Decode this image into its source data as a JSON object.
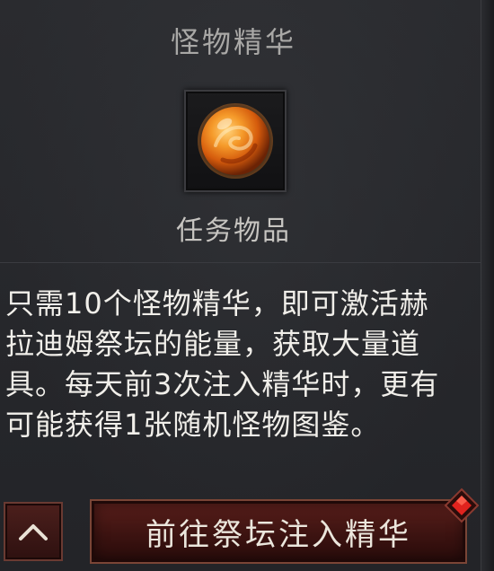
{
  "item": {
    "name": "怪物精华",
    "type": "任务物品",
    "icon": "orange-orb-icon"
  },
  "description": {
    "lines": [
      "只需10个怪物精华，即可激活赫",
      "拉迪姆祭坛的能量，获取大量道",
      "具。每天前3次注入精华时，更有",
      "可能获得1张随机怪物图鉴。"
    ]
  },
  "footer": {
    "back_icon": "chevron-up-icon",
    "action_label": "前往祭坛注入精华",
    "notification_icon": "red-diamond-icon"
  },
  "colors": {
    "background": "#26272b",
    "button": "#4a1a17",
    "orb": "#f07a16"
  }
}
